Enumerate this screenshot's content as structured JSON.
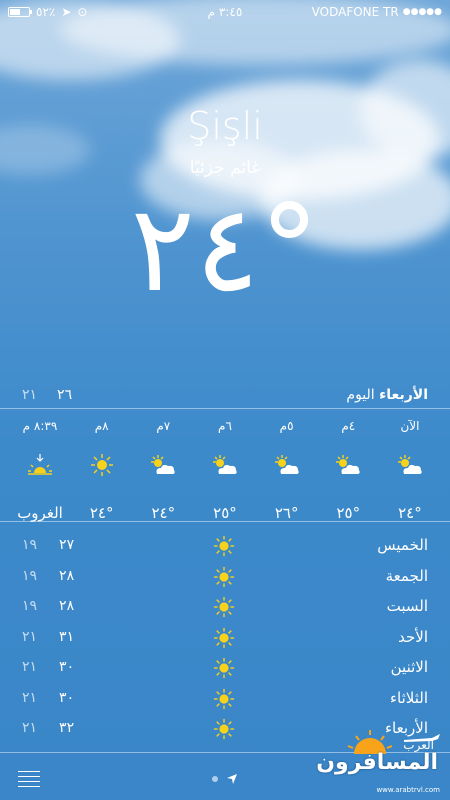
{
  "status_bar": {
    "battery_percent": "٥٢٪",
    "time": "٣:٤٥ م",
    "carrier": "VODAFONE TR",
    "signal": "●●●●●"
  },
  "location": {
    "city": "Şişli",
    "condition": "غائم جزئيًا",
    "temperature": "٢٤°"
  },
  "today": {
    "day": "الأربعاء",
    "label": "اليوم",
    "high": "٢٦",
    "low": "٢١"
  },
  "hourly": [
    {
      "time": "الآن",
      "icon": "partly-cloudy-icon",
      "temp": "٢٤°"
    },
    {
      "time": "٤م",
      "icon": "partly-cloudy-icon",
      "temp": "٢٥°"
    },
    {
      "time": "٥م",
      "icon": "partly-cloudy-icon",
      "temp": "٢٦°"
    },
    {
      "time": "٦م",
      "icon": "partly-cloudy-icon",
      "temp": "٢٥°"
    },
    {
      "time": "٧م",
      "icon": "partly-cloudy-icon",
      "temp": "٢٤°"
    },
    {
      "time": "٨م",
      "icon": "sun-icon",
      "temp": "٢٤°"
    },
    {
      "time": "٨:٣٩ م",
      "icon": "sunset-icon",
      "temp": "الغروب"
    }
  ],
  "daily": [
    {
      "day": "الخميس",
      "icon": "sun-icon",
      "high": "٢٧",
      "low": "١٩"
    },
    {
      "day": "الجمعة",
      "icon": "sun-icon",
      "high": "٢٨",
      "low": "١٩"
    },
    {
      "day": "السبت",
      "icon": "sun-icon",
      "high": "٢٨",
      "low": "١٩"
    },
    {
      "day": "الأحد",
      "icon": "sun-icon",
      "high": "٣١",
      "low": "٢١"
    },
    {
      "day": "الاثنين",
      "icon": "sun-icon",
      "high": "٣٠",
      "low": "٢١"
    },
    {
      "day": "الثلاثاء",
      "icon": "sun-icon",
      "high": "٣٠",
      "low": "٢١"
    },
    {
      "day": "الأربعاء",
      "icon": "sun-icon",
      "high": "٣٢",
      "low": "٢١"
    }
  ],
  "watermark": {
    "top": "العرب",
    "main": "المسافرون",
    "url": "www.arabtrvl.com"
  },
  "colors": {
    "sky_top": "#6ea6d8",
    "sky_bottom": "#3a86c8",
    "sun": "#f7d21a"
  }
}
